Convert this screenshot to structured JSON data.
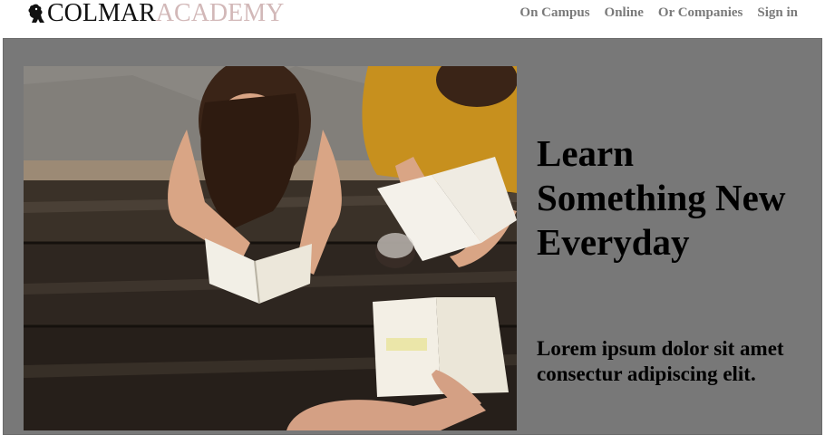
{
  "header": {
    "logo": {
      "icon": "lion-crest-icon",
      "word_primary": "COLMAR",
      "word_secondary": "ACADEMY",
      "primary_color": "#111111",
      "secondary_color": "#d2b8b8"
    },
    "nav": [
      {
        "label": "On Campus"
      },
      {
        "label": "Online"
      },
      {
        "label": "Or Companies"
      },
      {
        "label": "Sign in"
      }
    ]
  },
  "hero": {
    "background_color": "#787878",
    "image": {
      "subject": "students-studying-at-picnic-table-photo"
    },
    "heading": "Learn Something New Everyday",
    "subheading": "Lorem ipsum dolor sit amet consectur adipiscing elit."
  }
}
